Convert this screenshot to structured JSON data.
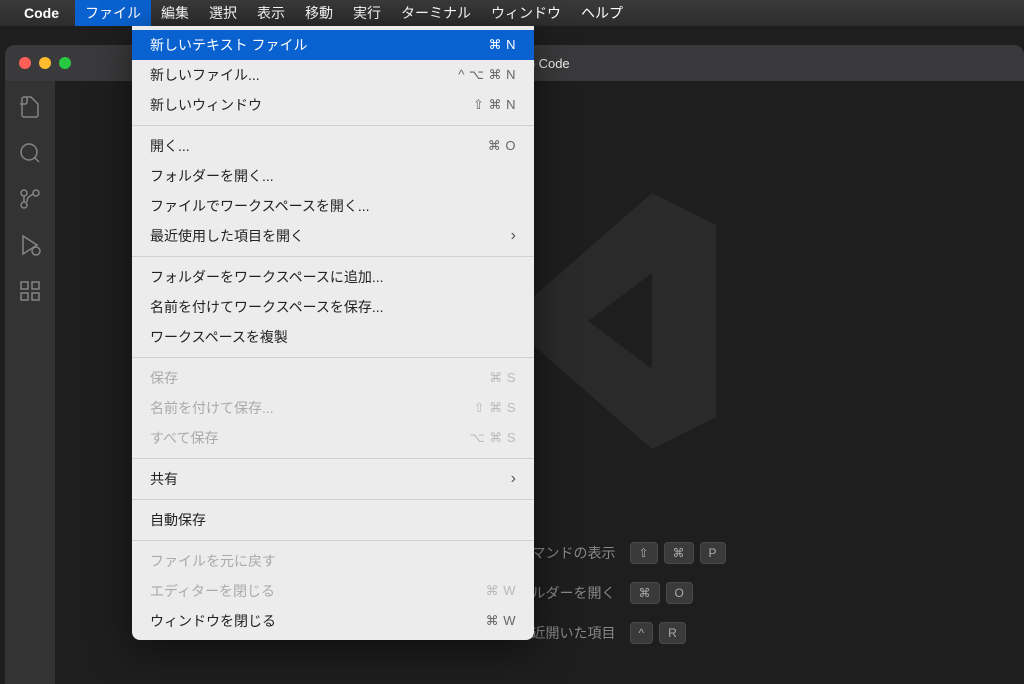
{
  "menubar": {
    "app_name": "Code",
    "items": [
      "ファイル",
      "編集",
      "選択",
      "表示",
      "移動",
      "実行",
      "ターミナル",
      "ウィンドウ",
      "ヘルプ"
    ],
    "active_index": 0
  },
  "window": {
    "title": "Visual Studio Code"
  },
  "dropdown": {
    "groups": [
      [
        {
          "label": "新しいテキスト ファイル",
          "shortcut": "⌘ N",
          "highlighted": true
        },
        {
          "label": "新しいファイル...",
          "shortcut": "^ ⌥ ⌘ N"
        },
        {
          "label": "新しいウィンドウ",
          "shortcut": "⇧ ⌘ N"
        }
      ],
      [
        {
          "label": "開く...",
          "shortcut": "⌘ O"
        },
        {
          "label": "フォルダーを開く..."
        },
        {
          "label": "ファイルでワークスペースを開く..."
        },
        {
          "label": "最近使用した項目を開く",
          "submenu": true
        }
      ],
      [
        {
          "label": "フォルダーをワークスペースに追加..."
        },
        {
          "label": "名前を付けてワークスペースを保存..."
        },
        {
          "label": "ワークスペースを複製"
        }
      ],
      [
        {
          "label": "保存",
          "shortcut": "⌘ S",
          "disabled": true
        },
        {
          "label": "名前を付けて保存...",
          "shortcut": "⇧ ⌘ S",
          "disabled": true
        },
        {
          "label": "すべて保存",
          "shortcut": "⌥ ⌘ S",
          "disabled": true
        }
      ],
      [
        {
          "label": "共有",
          "submenu": true
        }
      ],
      [
        {
          "label": "自動保存"
        }
      ],
      [
        {
          "label": "ファイルを元に戻す",
          "disabled": true
        },
        {
          "label": "エディターを閉じる",
          "shortcut": "⌘ W",
          "disabled": true
        },
        {
          "label": "ウィンドウを閉じる",
          "shortcut": "⌘ W"
        }
      ]
    ]
  },
  "shortcuts": [
    {
      "label": "すべてのコマンドの表示",
      "keys": [
        "⇧",
        "⌘",
        "P"
      ]
    },
    {
      "label": "イルまたはフォルダーを開く",
      "keys": [
        "⌘",
        "O"
      ]
    },
    {
      "label": "最近開いた項目",
      "keys": [
        "^",
        "R"
      ]
    }
  ],
  "activity_icons": [
    "files-icon",
    "search-icon",
    "source-control-icon",
    "run-debug-icon",
    "extensions-icon"
  ]
}
